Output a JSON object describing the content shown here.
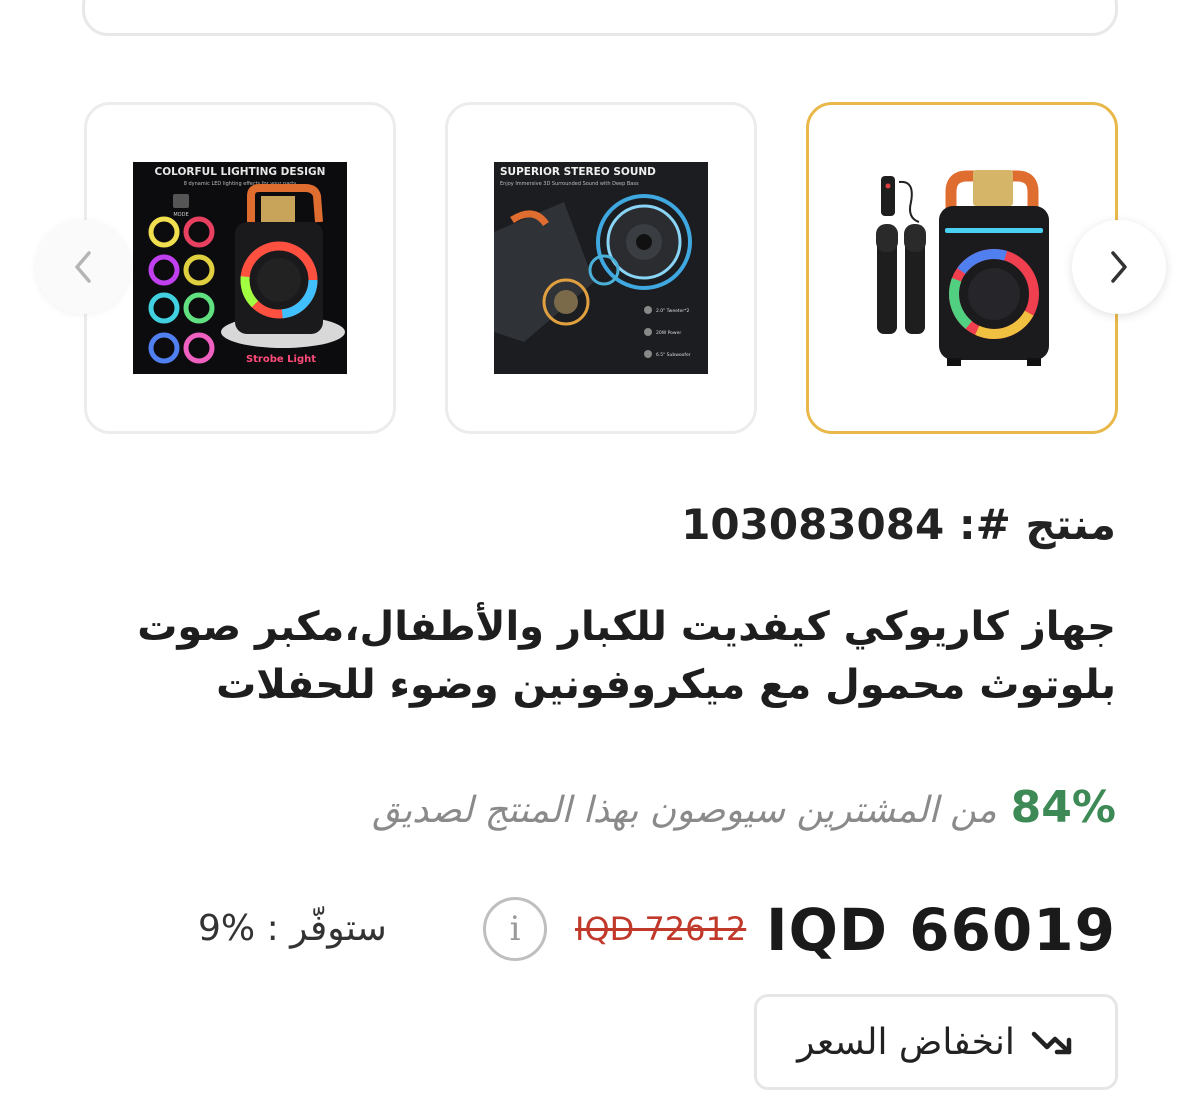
{
  "gallery": {
    "thumbnails": [
      {
        "alt": "karaoke speaker with two microphones and remote"
      },
      {
        "alt": "speaker driver illustration",
        "heading": "SUPERIOR STEREO SOUND",
        "subheading": "Enjoy Immersive 3D Surrounded Sound with Deep Bass",
        "specs": [
          "2.0\" Tweeter*2",
          "20W Power",
          "6.5\" Subwoofer"
        ]
      },
      {
        "alt": "colorful lighting modes",
        "heading": "COLORFUL LIGHTING DESIGN",
        "subheading": "8 dynamic LED lighting effects for your party",
        "mode_label": "MODE",
        "strobe_label": "Strobe Light"
      }
    ],
    "selected_index": 0,
    "prev_icon": "chevron-left-icon",
    "next_icon": "chevron-right-icon"
  },
  "product": {
    "code_line": "منتج #: 103083084",
    "title": "جهاز كاريوكي كيفديت للكبار والأطفال،مكبر صوت بلوتوث محمول مع ميكروفونين وضوء للحفلات"
  },
  "recommendation": {
    "percent": "84%",
    "text": "من المشترين سيوصون بهذا المنتج لصديق"
  },
  "pricing": {
    "price": "IQD 66019",
    "old_price": "IQD 72612",
    "info_icon": "i",
    "savings_label": "ستوفّر :",
    "savings_percent": "9%"
  },
  "price_drop": {
    "label": "انخفاض السعر",
    "icon": "trending-down-icon"
  },
  "colors": {
    "selected_border": "#e8b94a",
    "recommend_green": "#3d8a56",
    "old_price_red": "#c0392b"
  }
}
